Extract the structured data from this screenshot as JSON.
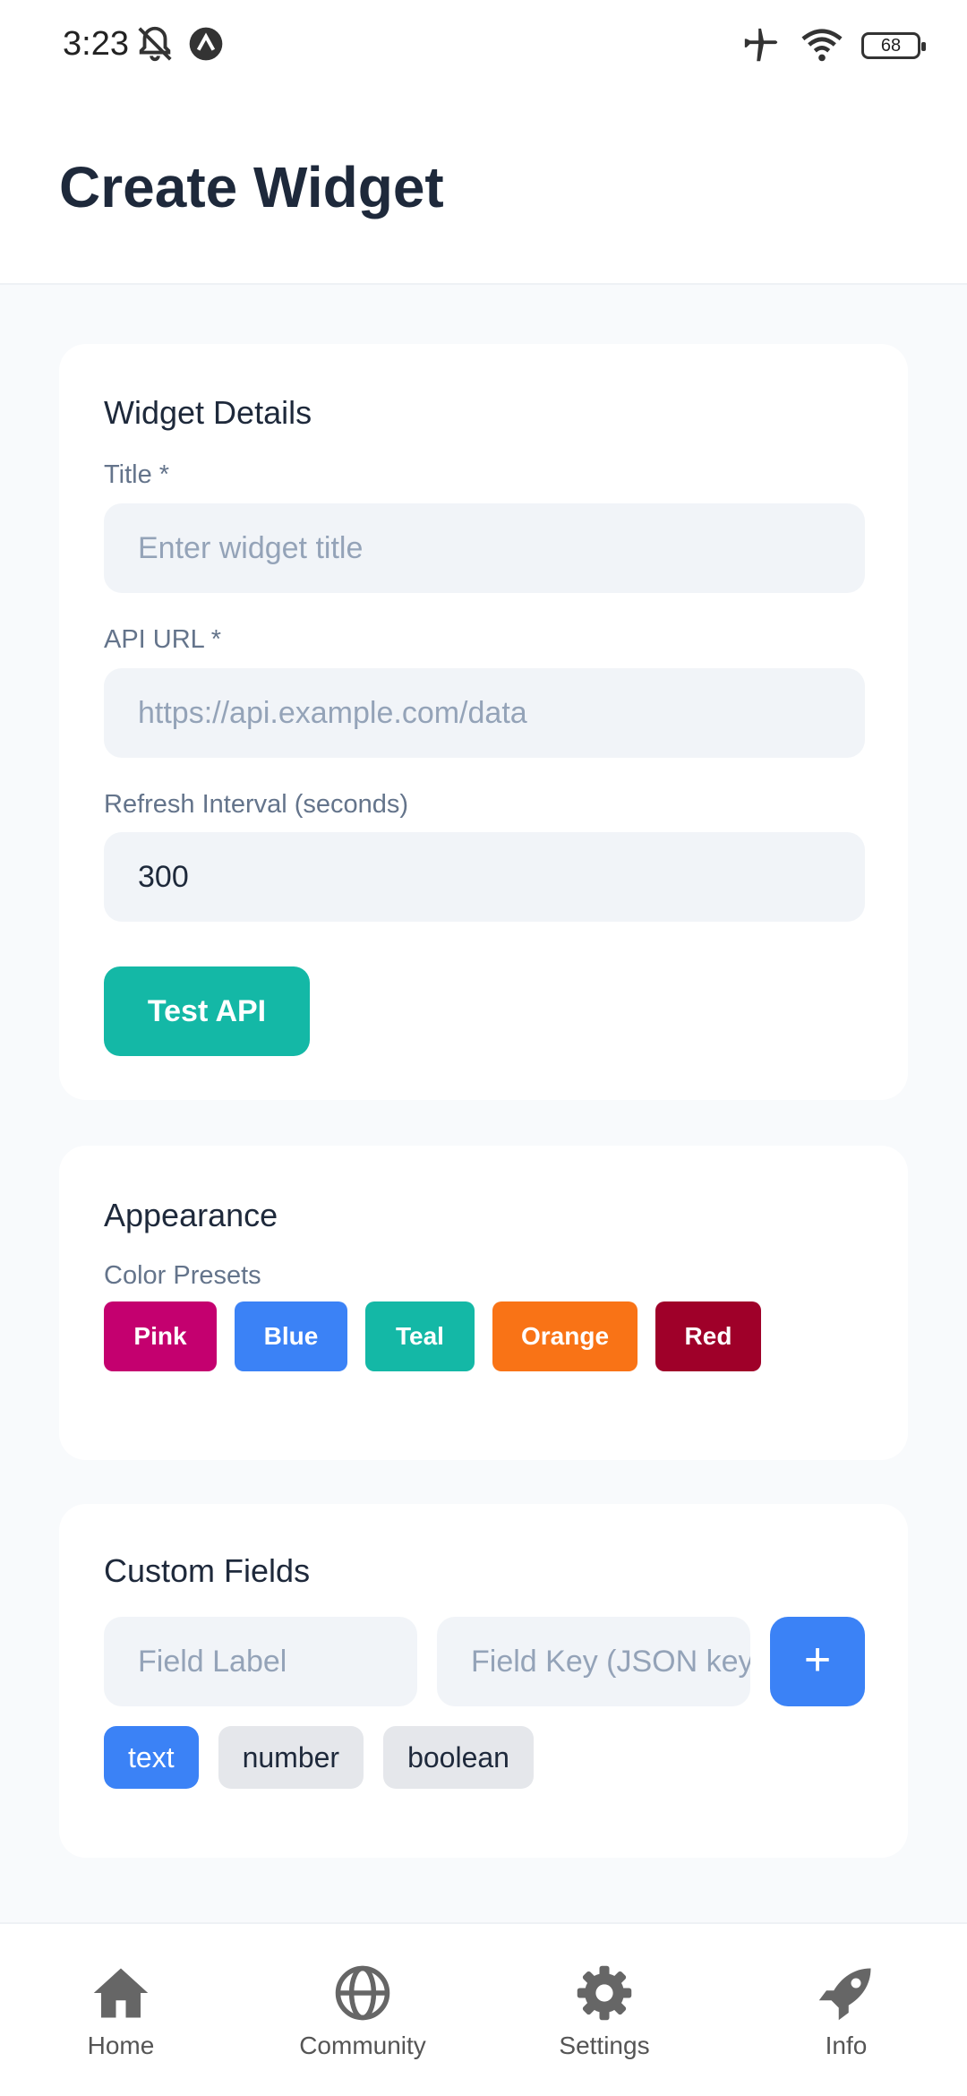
{
  "status": {
    "time": "3:23",
    "battery": "68"
  },
  "header": {
    "title": "Create Widget"
  },
  "details": {
    "title": "Widget Details",
    "title_label": "Title *",
    "title_placeholder": "Enter widget title",
    "url_label": "API URL *",
    "url_placeholder": "https://api.example.com/data",
    "refresh_label": "Refresh Interval (seconds)",
    "refresh_value": "300",
    "test_button": "Test API"
  },
  "appearance": {
    "title": "Appearance",
    "presets_label": "Color Presets",
    "presets": [
      {
        "label": "Pink",
        "color": "#c4006f"
      },
      {
        "label": "Blue",
        "color": "#3b82f6"
      },
      {
        "label": "Teal",
        "color": "#14b8a6"
      },
      {
        "label": "Orange",
        "color": "#f97316"
      },
      {
        "label": "Red",
        "color": "#9f0029"
      }
    ]
  },
  "custom": {
    "title": "Custom Fields",
    "label_placeholder": "Field Label",
    "key_placeholder": "Field Key (JSON key)",
    "add_button": "+",
    "types": [
      "text",
      "number",
      "boolean"
    ],
    "selected_type": "text"
  },
  "nav": {
    "items": [
      {
        "label": "Home",
        "icon": "home-icon"
      },
      {
        "label": "Community",
        "icon": "globe-icon"
      },
      {
        "label": "Settings",
        "icon": "gear-icon"
      },
      {
        "label": "Info",
        "icon": "rocket-icon"
      }
    ]
  }
}
